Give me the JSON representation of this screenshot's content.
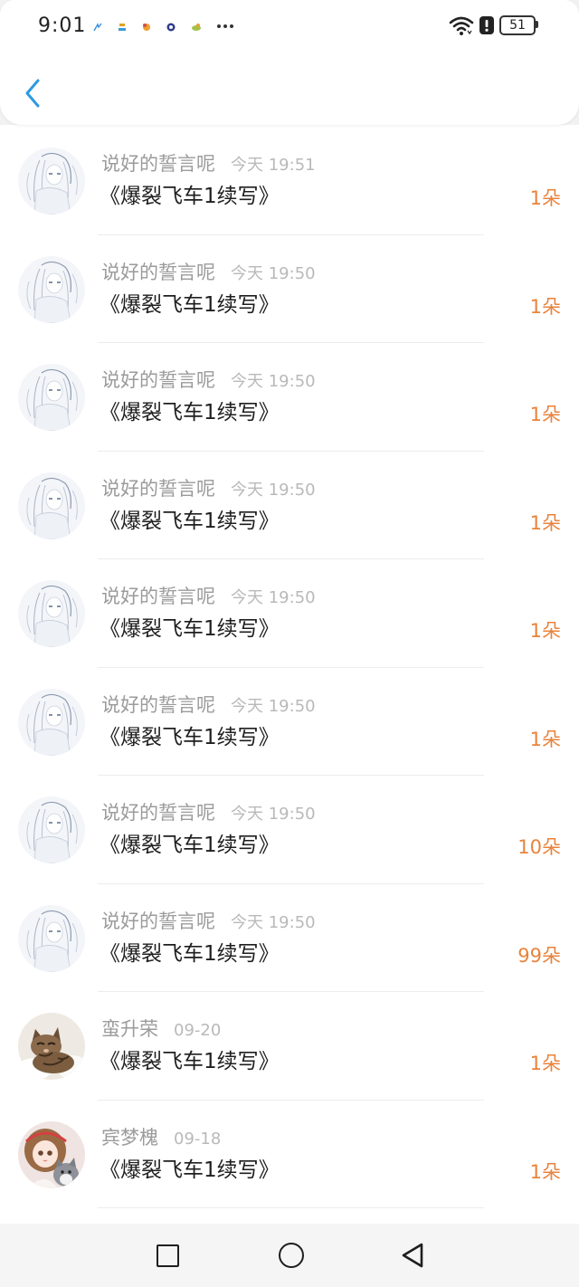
{
  "status_bar": {
    "time": "9:01",
    "battery": "51",
    "icons": [
      "notification-icon",
      "notification-icon",
      "notification-icon",
      "notification-icon",
      "notification-icon",
      "more-notifications-icon",
      "wifi-icon",
      "alert-icon",
      "battery-icon"
    ]
  },
  "header": {
    "back_icon": "chevron-left-icon"
  },
  "colors": {
    "accent": "#2c9ae2",
    "amount": "#e8833c",
    "name": "#9b9b9b",
    "time": "#b9b9b9",
    "title": "#1e1e1e"
  },
  "rows": [
    {
      "name": "说好的誓言呢",
      "time": "今天 19:51",
      "title": "《爆裂飞车1续写》",
      "amount": "1朵",
      "avatar": "sketch-avatar-icon"
    },
    {
      "name": "说好的誓言呢",
      "time": "今天 19:50",
      "title": "《爆裂飞车1续写》",
      "amount": "1朵",
      "avatar": "sketch-avatar-icon"
    },
    {
      "name": "说好的誓言呢",
      "time": "今天 19:50",
      "title": "《爆裂飞车1续写》",
      "amount": "1朵",
      "avatar": "sketch-avatar-icon"
    },
    {
      "name": "说好的誓言呢",
      "time": "今天 19:50",
      "title": "《爆裂飞车1续写》",
      "amount": "1朵",
      "avatar": "sketch-avatar-icon"
    },
    {
      "name": "说好的誓言呢",
      "time": "今天 19:50",
      "title": "《爆裂飞车1续写》",
      "amount": "1朵",
      "avatar": "sketch-avatar-icon"
    },
    {
      "name": "说好的誓言呢",
      "time": "今天 19:50",
      "title": "《爆裂飞车1续写》",
      "amount": "1朵",
      "avatar": "sketch-avatar-icon"
    },
    {
      "name": "说好的誓言呢",
      "time": "今天 19:50",
      "title": "《爆裂飞车1续写》",
      "amount": "10朵",
      "avatar": "sketch-avatar-icon"
    },
    {
      "name": "说好的誓言呢",
      "time": "今天 19:50",
      "title": "《爆裂飞车1续写》",
      "amount": "99朵",
      "avatar": "sketch-avatar-icon"
    },
    {
      "name": "蛮升荣",
      "time": "09-20",
      "title": "《爆裂飞车1续写》",
      "amount": "1朵",
      "avatar": "cat-avatar-icon"
    },
    {
      "name": "宾梦槐",
      "time": "09-18",
      "title": "《爆裂飞车1续写》",
      "amount": "1朵",
      "avatar": "doll-avatar-icon"
    }
  ],
  "nav_bar": {
    "recents_icon": "square-icon",
    "home_icon": "circle-icon",
    "back_icon": "triangle-back-icon"
  }
}
